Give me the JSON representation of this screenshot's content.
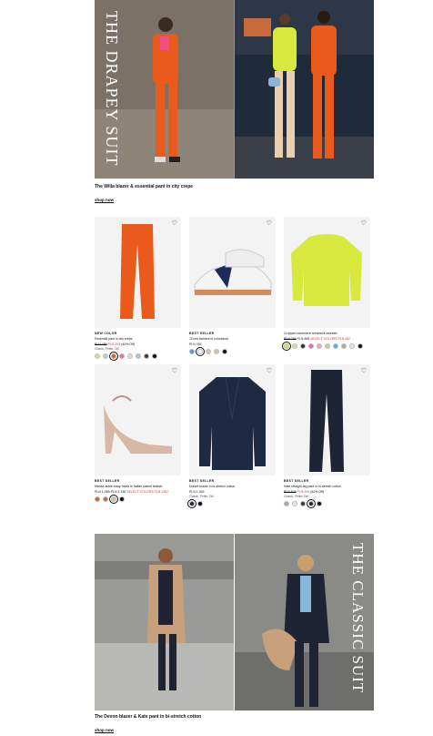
{
  "hero_top": {
    "title": "THE DRAPEY SUIT",
    "caption": "The Willa blazer & essential pant in city crepe",
    "cta": "shop now"
  },
  "products": [
    {
      "badge": "NEW COLOR",
      "name": "Essential pant in city crepe",
      "price_old": "PLN 489",
      "price_sale": "PLN 293",
      "price_note": "(40% Off)",
      "sizes": "Classic, Petite, Tall",
      "swatches": [
        "#d9e0a0",
        "#c8d4a6",
        "#e85a1c",
        "#ef6aa8",
        "#f3d6c6",
        "#a7c8de",
        "#3a3a3a",
        "#111111"
      ],
      "selected": 2
    },
    {
      "badge": "BEST SELLER",
      "name": "JCrew trainers in colorblock",
      "price": "PLN 354",
      "sizes": "",
      "swatches": [
        "#4a9fd8",
        "#f4f4f4",
        "#c9c9b2",
        "#d7c3a8",
        "#111111"
      ],
      "selected": 1
    },
    {
      "badge": "",
      "name": "Cropped cashmere crewneck sweater",
      "price_old": "PLN 755",
      "price_sale": "PLN 565",
      "price_note": "SELECT COLORS PLN 452",
      "sizes": "",
      "swatches": [
        "#d8e83c",
        "#e8d4b0",
        "#333333",
        "#e36aa8",
        "#f0a7b5",
        "#d8c8a0",
        "#4fb3e0",
        "#a9a9a9",
        "#e4e4e4",
        "#111111"
      ],
      "selected": 0
    },
    {
      "badge": "BEST SELLER",
      "name": "Marisa ankle-strap heels in Italian patent leather",
      "price": "PLN 1,265-PLN 1,335",
      "price_sale": "SELECT COLORS PLN 1262",
      "sizes": "",
      "swatches": [
        "#e85a1c",
        "#c0684a",
        "#d8b8a4",
        "#111111"
      ],
      "selected": 2
    },
    {
      "badge": "BEST SELLER",
      "name": "Dorset blazer in bi-stretch cotton",
      "price": "PLN 1,334",
      "sizes": "Classic, Petite, Tall",
      "swatches": [
        "#1e2a44",
        "#111111"
      ],
      "selected": 0
    },
    {
      "badge": "BEST SELLER",
      "name": "Kate straight-leg pant in bi-stretch cotton",
      "price_old": "PLN 875",
      "price_sale": "PLN 444",
      "price_note": "(40% Off)",
      "sizes": "Classic, Petite, Tall",
      "swatches": [
        "#b8a0c8",
        "#e6e6e6",
        "#3a3a3a",
        "#1e2a44",
        "#111111"
      ],
      "selected": 3
    }
  ],
  "hero_bottom": {
    "title": "THE CLASSIC SUIT",
    "caption": "The Devon blazer & Kate pant in bi-stretch cotton",
    "cta": "shop now"
  },
  "icons": {
    "heart": "heart-icon"
  }
}
